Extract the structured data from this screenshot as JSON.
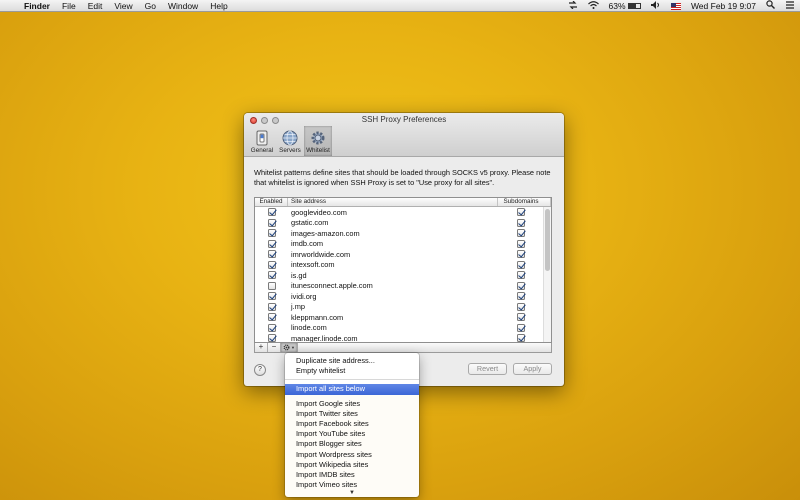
{
  "menubar": {
    "app": "Finder",
    "items": [
      "File",
      "Edit",
      "View",
      "Go",
      "Window",
      "Help"
    ],
    "battery_pct": "63%",
    "battery_level": 0.63,
    "clock": "Wed Feb 19  9:07"
  },
  "window": {
    "title": "SSH Proxy Preferences",
    "toolbar": [
      "General",
      "Servers",
      "Whitelist"
    ],
    "selected_tab": "Whitelist",
    "description": "Whitelist patterns define sites that should be loaded through SOCKS v5 proxy. Please note that whitelist is ignored when SSH Proxy is set to \"Use proxy for all sites\".",
    "table": {
      "headers": [
        "Enabled",
        "Site address",
        "Subdomains"
      ],
      "rows": [
        {
          "site": "googlevideo.com",
          "enabled": true,
          "subdomains": true
        },
        {
          "site": "gstatic.com",
          "enabled": true,
          "subdomains": true
        },
        {
          "site": "images-amazon.com",
          "enabled": true,
          "subdomains": true
        },
        {
          "site": "imdb.com",
          "enabled": true,
          "subdomains": true
        },
        {
          "site": "imrworldwide.com",
          "enabled": true,
          "subdomains": true
        },
        {
          "site": "intexsoft.com",
          "enabled": true,
          "subdomains": true
        },
        {
          "site": "is.gd",
          "enabled": true,
          "subdomains": true
        },
        {
          "site": "itunesconnect.apple.com",
          "enabled": false,
          "subdomains": true
        },
        {
          "site": "ividi.org",
          "enabled": true,
          "subdomains": true
        },
        {
          "site": "j.mp",
          "enabled": true,
          "subdomains": true
        },
        {
          "site": "kleppmann.com",
          "enabled": true,
          "subdomains": true
        },
        {
          "site": "linode.com",
          "enabled": true,
          "subdomains": true
        },
        {
          "site": "manager.linode.com",
          "enabled": true,
          "subdomains": true
        }
      ]
    },
    "add_label": "+",
    "remove_label": "−",
    "help_label": "?",
    "revert_label": "Revert",
    "apply_label": "Apply"
  },
  "menu": {
    "group1": [
      "Duplicate site address...",
      "Empty whitelist"
    ],
    "highlighted": "Import all sites below",
    "group2": [
      "Import Google sites",
      "Import Twitter sites",
      "Import Facebook sites",
      "Import YouTube sites",
      "Import Blogger sites",
      "Import Wordpress sites",
      "Import Wikipedia sites",
      "Import IMDB sites",
      "Import Vimeo sites"
    ],
    "more_indicator": "▼"
  },
  "colors": {
    "desktop": "#e8b313",
    "menu_highlight": "#3b66d6",
    "checkbox_check": "#1a3e7a"
  }
}
